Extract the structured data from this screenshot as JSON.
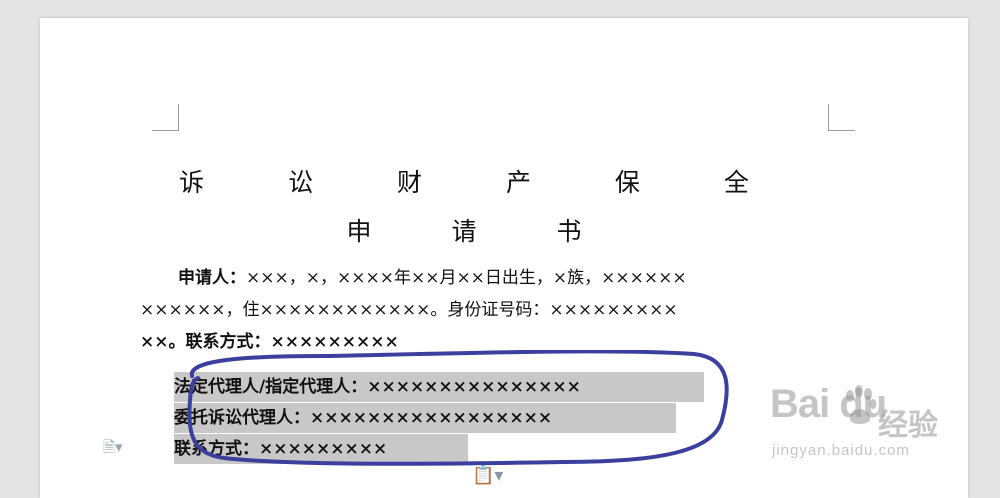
{
  "document": {
    "title_line1": "诉 讼 财 产 保 全",
    "title_line2": "申 请 书",
    "applicant": {
      "line1_label": "申请人：",
      "line1_text": "×××，×，××××年××月××日出生，×族，××××××",
      "line2_text": "××××××，住××××××××××××。身份证号码：×××××××××",
      "line3_text": "××。联系方式：×××××××××"
    },
    "highlighted": {
      "legal_agent": "法定代理人/指定代理人：×××××××××××××××",
      "litigation_agent": "委托诉讼代理人：×××××××××××××××××",
      "contact": "联系方式：×××××××××"
    }
  },
  "annotation": {
    "circle_color": "#3b3f9e"
  },
  "watermark": {
    "brand": "Bai du",
    "cn": "经验",
    "url": "jingyan.baidu.com"
  },
  "icons": {
    "side": "document-options-icon",
    "paste": "paste-options-icon"
  }
}
